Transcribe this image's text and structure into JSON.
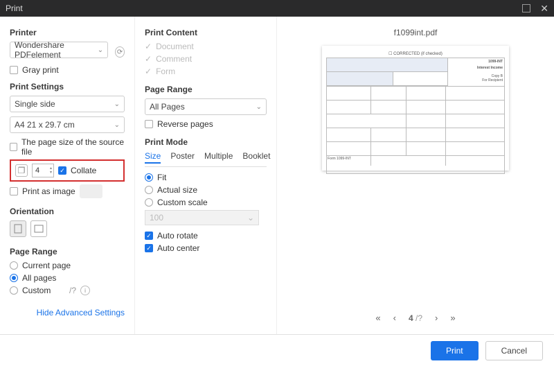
{
  "title": "Print",
  "col1": {
    "printer_title": "Printer",
    "printer_value": "Wondershare PDFelement",
    "gray_print": "Gray print",
    "settings_title": "Print Settings",
    "side_value": "Single side",
    "paper_value": "A4 21 x 29.7 cm",
    "source_size": "The page size of the source file",
    "copies_value": "4",
    "collate": "Collate",
    "print_as_image": "Print as image",
    "orientation_title": "Orientation",
    "page_range_title": "Page Range",
    "current_page": "Current page",
    "all_pages": "All pages",
    "custom": "Custom",
    "advanced_link": "Hide Advanced Settings"
  },
  "col2": {
    "content_title": "Print Content",
    "doc": "Document",
    "comment": "Comment",
    "form": "Form",
    "range_title": "Page Range",
    "all_pages_value": "All Pages",
    "reverse": "Reverse pages",
    "mode_title": "Print Mode",
    "tabs": [
      "Size",
      "Poster",
      "Multiple",
      "Booklet"
    ],
    "fit": "Fit",
    "actual": "Actual size",
    "custom_scale": "Custom scale",
    "scale_value": "100",
    "auto_rotate": "Auto rotate",
    "auto_center": "Auto center"
  },
  "preview": {
    "filename": "f1099int.pdf",
    "corrected": "☐ CORRECTED (if checked)",
    "form_no": "1099-INT",
    "heading": "Interest Income",
    "copy": "Copy B",
    "recipient": "For Recipient",
    "footer_form": "Form 1099-INT",
    "pager_current": "4",
    "pager_total": "/?"
  },
  "footer": {
    "print": "Print",
    "cancel": "Cancel"
  }
}
